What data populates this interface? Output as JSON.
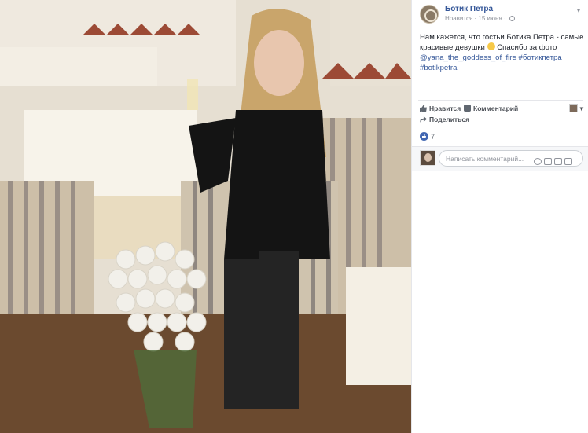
{
  "photo": {
    "alt_subject": "photo"
  },
  "post": {
    "page_name": "Ботик Петра",
    "meta_liked": "Нравится",
    "meta_separator": " · ",
    "meta_date": "15 июня",
    "meta_separator2": " · ",
    "text_part1": "Нам кажется, что гостьи Ботика Петра - самые красивые девушки ",
    "text_part2": " Спасибо за фото ",
    "mention": "@yana_the_goddess_of_fire",
    "hashtag1": "#ботикпетра",
    "hashtag2": "#botikpetra"
  },
  "actions": {
    "like_label": "Нравится",
    "comment_label": "Комментарий",
    "share_label": "Поделиться"
  },
  "reactions": {
    "count": "7"
  },
  "comment_box": {
    "placeholder": "Написать комментарий..."
  },
  "colors": {
    "link": "#365899",
    "like_blue": "#4267b2",
    "text": "#1d2129",
    "muted": "#90949c"
  }
}
